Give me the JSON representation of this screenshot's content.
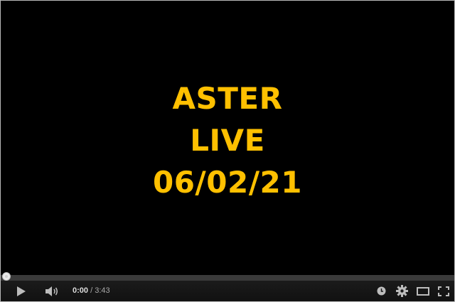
{
  "video": {
    "title_lines": [
      "ASTER",
      "LIVE",
      "06/02/21"
    ]
  },
  "player": {
    "current_time": "0:00",
    "separator": " / ",
    "duration": "3:43",
    "progress_fraction": 0
  },
  "icons": {
    "play": "play-icon",
    "volume": "volume-icon",
    "clock": "watch-later-icon",
    "settings": "gear-icon",
    "theater": "theater-mode-icon",
    "fullscreen": "fullscreen-icon"
  },
  "colors": {
    "title_text": "#ffc000",
    "background": "#000000",
    "progress_played": "#cc181e"
  }
}
